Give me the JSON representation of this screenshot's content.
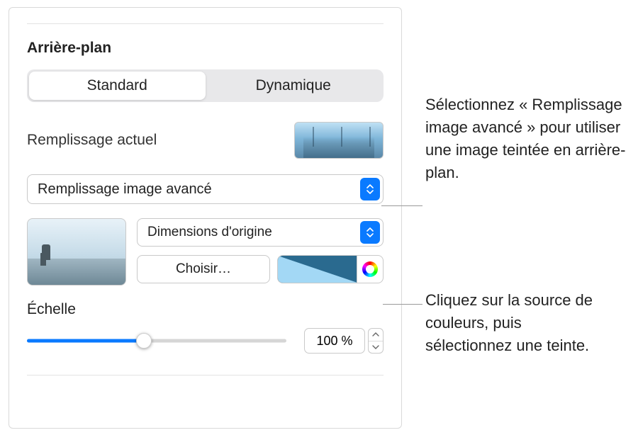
{
  "section_title": "Arrière-plan",
  "segmented": {
    "standard": "Standard",
    "dynamic": "Dynamique"
  },
  "current_fill_label": "Remplissage actuel",
  "fill_type": "Remplissage image avancé",
  "image_scale_mode": "Dimensions d'origine",
  "choose_label": "Choisir…",
  "scale_label": "Échelle",
  "scale_value": "100 %",
  "callouts": {
    "c1": "Sélectionnez « Remplissage image avancé » pour utiliser une image teintée en arrière-plan.",
    "c2": "Cliquez sur la source de couleurs, puis sélectionnez une teinte."
  }
}
